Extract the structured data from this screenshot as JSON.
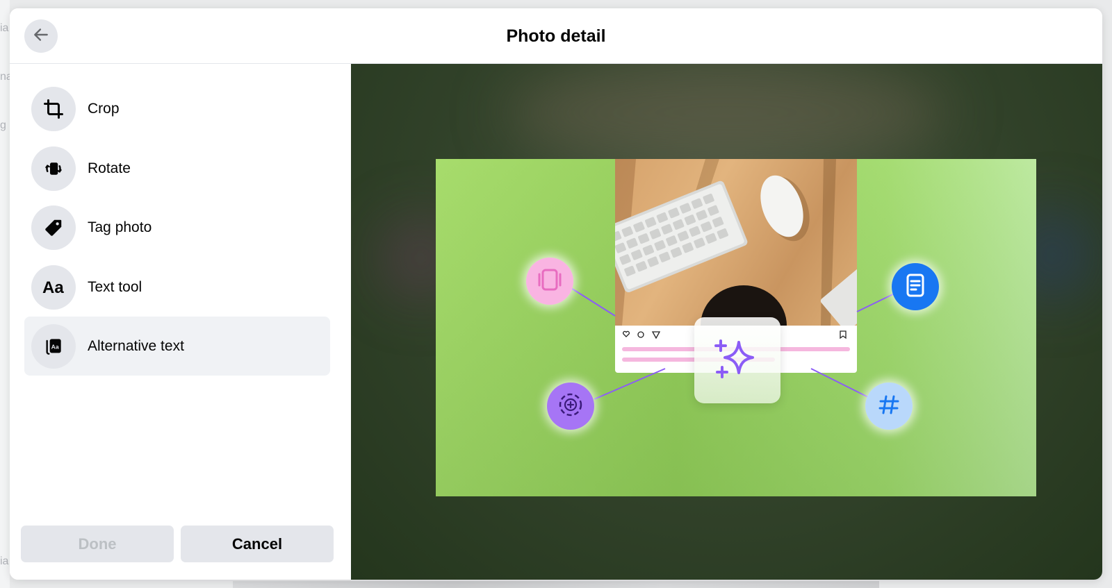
{
  "background": {
    "fragments": [
      "ia",
      "na",
      "g",
      "ia"
    ]
  },
  "dialog": {
    "title": "Photo detail",
    "back_icon": "arrow-left-icon"
  },
  "sidebar": {
    "tools": [
      {
        "label": "Crop",
        "icon": "crop-icon",
        "selected": false
      },
      {
        "label": "Rotate",
        "icon": "rotate-icon",
        "selected": false
      },
      {
        "label": "Tag photo",
        "icon": "tag-icon",
        "selected": false
      },
      {
        "label": "Text tool",
        "icon": "text-tool-icon",
        "selected": false
      },
      {
        "label": "Alternative text",
        "icon": "alt-text-icon",
        "selected": true
      }
    ]
  },
  "actions": {
    "done_label": "Done",
    "done_enabled": false,
    "cancel_label": "Cancel"
  },
  "preview": {
    "image_description_icons": [
      "sparkle-icon",
      "carousel-icon",
      "document-icon",
      "add-circle-icon",
      "hashtag-icon"
    ],
    "colors": {
      "frame_bg": "#34442c",
      "photo_green": "#97cf5e",
      "purple": "#8b5cf6",
      "pink": "#f9b4e2",
      "blue": "#1877f2"
    }
  }
}
